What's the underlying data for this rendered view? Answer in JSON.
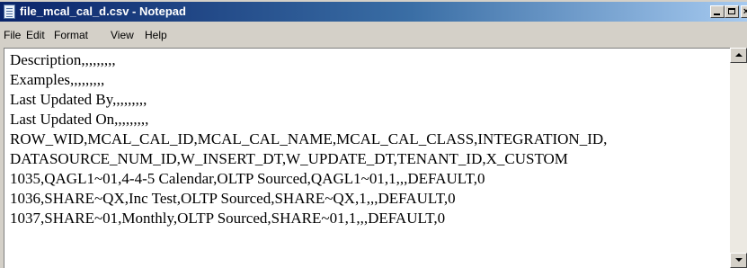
{
  "window": {
    "title": "file_mcal_cal_d.csv - Notepad"
  },
  "menu": [
    "File",
    "Edit",
    "Format",
    "View",
    "Help"
  ],
  "document": {
    "lines": [
      "Description,,,,,,,,,",
      "Examples,,,,,,,,,",
      "Last Updated By,,,,,,,,,",
      "Last Updated On,,,,,,,,,",
      "ROW_WID,MCAL_CAL_ID,MCAL_CAL_NAME,MCAL_CAL_CLASS,INTEGRATION_ID,",
      "DATASOURCE_NUM_ID,W_INSERT_DT,W_UPDATE_DT,TENANT_ID,X_CUSTOM",
      "1035,QAGL1~01,4-4-5 Calendar,OLTP Sourced,QAGL1~01,1,,,DEFAULT,0",
      "1036,SHARE~QX,Inc Test,OLTP Sourced,SHARE~QX,1,,,DEFAULT,0",
      "1037,SHARE~01,Monthly,OLTP Sourced,SHARE~01,1,,,DEFAULT,0"
    ]
  },
  "icons": {
    "title": "notepad-icon",
    "minimize": "minimize-icon",
    "maximize": "maximize-icon",
    "close": "close-icon"
  },
  "colors": {
    "titlebar_start": "#0a246a",
    "titlebar_end": "#a6caf0",
    "chrome": "#d4d0c8"
  }
}
